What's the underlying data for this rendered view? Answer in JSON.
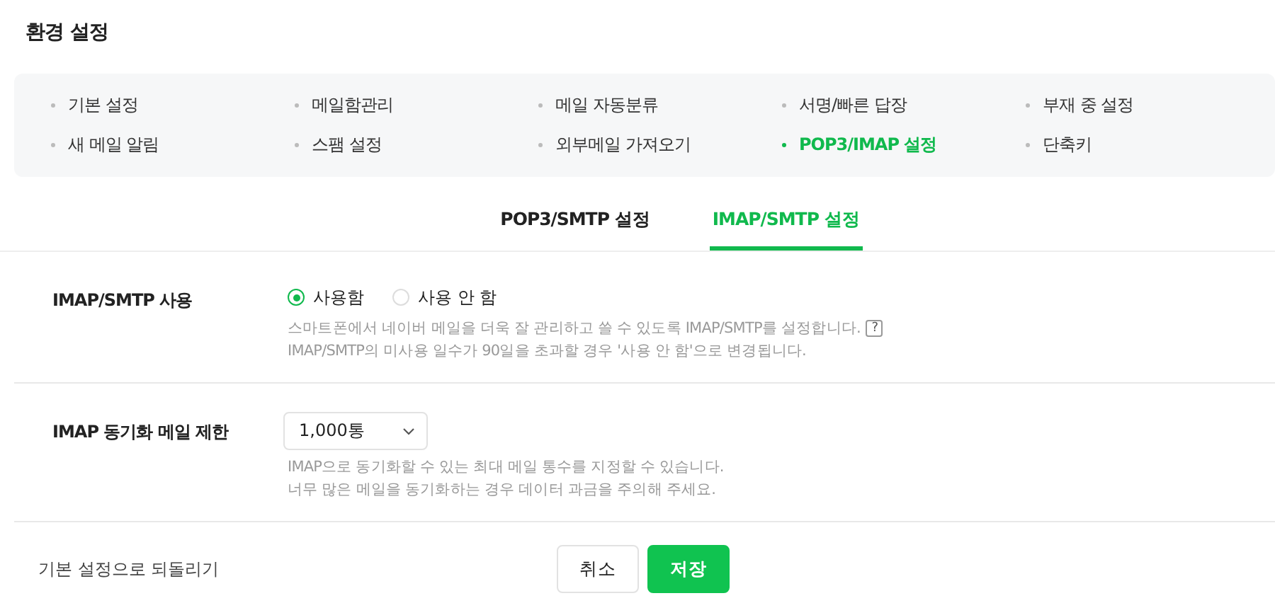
{
  "page_title": "환경 설정",
  "menu": [
    {
      "label": "기본 설정",
      "selected": false
    },
    {
      "label": "메일함관리",
      "selected": false
    },
    {
      "label": "메일 자동분류",
      "selected": false
    },
    {
      "label": "서명/빠른 답장",
      "selected": false
    },
    {
      "label": "부재 중 설정",
      "selected": false
    },
    {
      "label": "새 메일 알림",
      "selected": false
    },
    {
      "label": "스팸 설정",
      "selected": false
    },
    {
      "label": "외부메일 가져오기",
      "selected": false
    },
    {
      "label": "POP3/IMAP 설정",
      "selected": true
    },
    {
      "label": "단축키",
      "selected": false
    }
  ],
  "tabs": [
    {
      "label": "POP3/SMTP 설정",
      "selected": false
    },
    {
      "label": "IMAP/SMTP 설정",
      "selected": true
    }
  ],
  "settings": [
    {
      "kind": "radio",
      "label": "IMAP/SMTP 사용",
      "options": [
        {
          "label": "사용함",
          "selected": true
        },
        {
          "label": "사용 안 함",
          "selected": false
        }
      ],
      "help": [
        "스마트폰에서 네이버 메일을 더욱 잘 관리하고 쓸 수 있도록 IMAP/SMTP를 설정합니다.",
        "IMAP/SMTP의 미사용 일수가 90일을 초과할 경우 '사용 안 함'으로 변경됩니다."
      ],
      "help_mark": "?"
    },
    {
      "kind": "select",
      "label": "IMAP 동기화 메일 제한",
      "value": "1,000통",
      "help": [
        "IMAP으로 동기화할 수 있는 최대 메일 통수를 지정할 수 있습니다.",
        "너무 많은 메일을 동기화하는 경우 데이터 과금을 주의해 주세요."
      ]
    }
  ],
  "footer": {
    "reset_link": "기본 설정으로 되돌리기",
    "buttons": [
      {
        "label": "취소",
        "kind": "secondary"
      },
      {
        "label": "저장",
        "kind": "primary"
      }
    ]
  }
}
